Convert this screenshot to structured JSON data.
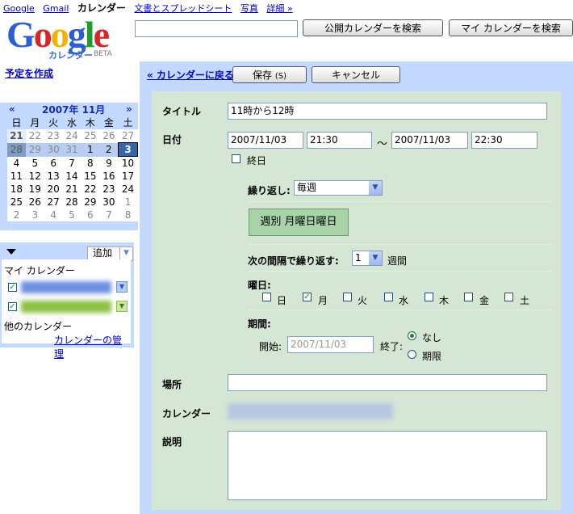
{
  "nav": {
    "items": [
      "Google",
      "Gmail",
      "カレンダー",
      "文書とスプレッドシート",
      "写真",
      "詳細 »"
    ]
  },
  "logo": {
    "word": "Google",
    "sub": "カレンダー",
    "beta": "BETA"
  },
  "search": {
    "value": "",
    "public_button": "公開カレンダーを検索",
    "my_button": "マイ カレンダーを検索"
  },
  "create_link": "予定を作成",
  "minical": {
    "prev": "«",
    "next": "»",
    "title": "2007年 11月",
    "weekdays": [
      "日",
      "月",
      "火",
      "水",
      "木",
      "金",
      "土"
    ],
    "weeks": [
      [
        "21",
        "22",
        "23",
        "24",
        "25",
        "26",
        "27"
      ],
      [
        "28",
        "29",
        "30",
        "31",
        "1",
        "2",
        "3"
      ],
      [
        "4",
        "5",
        "6",
        "7",
        "8",
        "9",
        "10"
      ],
      [
        "11",
        "12",
        "13",
        "14",
        "15",
        "16",
        "17"
      ],
      [
        "18",
        "19",
        "20",
        "21",
        "22",
        "23",
        "24"
      ],
      [
        "25",
        "26",
        "27",
        "28",
        "29",
        "30",
        "1"
      ],
      [
        "2",
        "3",
        "4",
        "5",
        "6",
        "7",
        "8"
      ]
    ]
  },
  "calendars": {
    "add_label": "追加",
    "add_arrow": "▼",
    "my_heading": "マイ カレンダー",
    "other_heading": "他のカレンダー",
    "manage_link": "カレンダーの管理",
    "items": [
      {
        "color": "#6d8fe0",
        "checked": "✓"
      },
      {
        "color": "#8ec046",
        "checked": "✓"
      }
    ]
  },
  "toolbar": {
    "back_link": "« カレンダーに戻る",
    "save": "保存",
    "save_key": "(S)",
    "cancel": "キャンセル"
  },
  "form": {
    "title_label": "タイトル",
    "title_value": "11時から12時",
    "date_label": "日付",
    "start_date": "2007/11/03",
    "start_time": "21:30",
    "tilde": "～",
    "end_date": "2007/11/03",
    "end_time": "22:30",
    "allday_label": "終日",
    "repeat_label": "繰り返し:",
    "repeat_value": "毎週",
    "summary": "週別 月曜日曜日",
    "interval_label": "次の間隔で繰り返す:",
    "interval_value": "1",
    "interval_unit": "週間",
    "weekday_label": "曜日:",
    "weekdays": [
      {
        "label": "日",
        "checked": ""
      },
      {
        "label": "月",
        "checked": "✓"
      },
      {
        "label": "火",
        "checked": ""
      },
      {
        "label": "水",
        "checked": ""
      },
      {
        "label": "木",
        "checked": ""
      },
      {
        "label": "金",
        "checked": ""
      },
      {
        "label": "土",
        "checked": ""
      }
    ],
    "range_label": "期間:",
    "range_start_label": "開始:",
    "range_start_value": "2007/11/03",
    "range_end_label": "終了:",
    "range_none": "なし",
    "range_until": "期限",
    "location_label": "場所",
    "location_value": "",
    "calendar_label": "カレンダー",
    "description_label": "説明",
    "description_value": ""
  },
  "colors": {
    "accent": "#c3d9ff",
    "form_bg": "#d6e6d4",
    "link": "#0000cc"
  }
}
